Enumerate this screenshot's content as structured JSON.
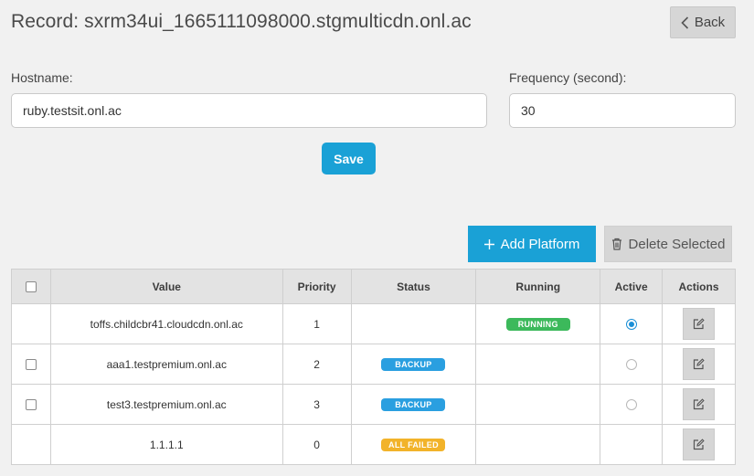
{
  "header": {
    "title": "Record: sxrm34ui_1665111098000.stgmulticdn.onl.ac",
    "back_label": "Back"
  },
  "form": {
    "hostname_label": "Hostname:",
    "hostname_value": "ruby.testsit.onl.ac",
    "frequency_label": "Frequency (second):",
    "frequency_value": "30",
    "save_label": "Save"
  },
  "toolbar": {
    "add_label": "Add Platform",
    "delete_label": "Delete Selected"
  },
  "table": {
    "columns": [
      "Value",
      "Priority",
      "Status",
      "Running",
      "Active",
      "Actions"
    ],
    "rows": [
      {
        "value": "toffs.childcbr41.cloudcdn.onl.ac",
        "priority": "1",
        "status": "",
        "running": "RUNNING",
        "active": true,
        "checkbox": false
      },
      {
        "value": "aaa1.testpremium.onl.ac",
        "priority": "2",
        "status": "BACKUP",
        "running": "",
        "active": false,
        "checkbox": true
      },
      {
        "value": "test3.testpremium.onl.ac",
        "priority": "3",
        "status": "BACKUP",
        "running": "",
        "active": false,
        "checkbox": true
      },
      {
        "value": "1.1.1.1",
        "priority": "0",
        "status": "ALL FAILED",
        "running": "",
        "active": null,
        "checkbox": false
      }
    ]
  },
  "colors": {
    "primary": "#1aa1d6",
    "running": "#3cb95b",
    "backup": "#2a9fe0",
    "all_failed": "#f2b32a"
  }
}
